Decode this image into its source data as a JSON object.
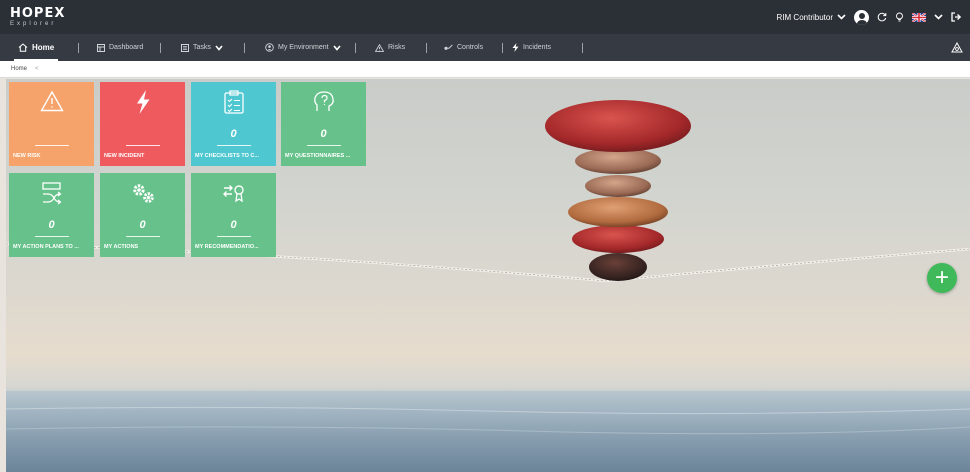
{
  "app": {
    "logo_main": "HOPEX",
    "logo_sub": "Explorer"
  },
  "header": {
    "user_role": "RIM Contributor"
  },
  "nav": {
    "home": "Home",
    "dashboard": "Dashboard",
    "tasks": "Tasks",
    "my_environment": "My Environment",
    "risks": "Risks",
    "controls": "Controls",
    "incidents": "Incidents"
  },
  "breadcrumb": {
    "current": "Home",
    "separator": "<"
  },
  "tiles": [
    {
      "label": "NEW RISK",
      "count": "",
      "color": "#f5a36a",
      "icon": "warning-icon"
    },
    {
      "label": "NEW INCIDENT",
      "count": "",
      "color": "#ef5a5f",
      "icon": "lightning-icon"
    },
    {
      "label": "MY CHECKLISTS TO C...",
      "count": "0",
      "color": "#4ec7d0",
      "icon": "checklist-icon"
    },
    {
      "label": "MY QUESTIONNAIRES ...",
      "count": "0",
      "color": "#66c28a",
      "icon": "questionnaire-icon"
    },
    {
      "label": "MY ACTION PLANS TO ...",
      "count": "0",
      "color": "#66c28a",
      "icon": "action-plan-icon"
    },
    {
      "label": "MY ACTIONS",
      "count": "0",
      "color": "#66c28a",
      "icon": "gears-icon"
    },
    {
      "label": "MY RECOMMENDATIO...",
      "count": "0",
      "color": "#66c28a",
      "icon": "recommendation-icon"
    }
  ],
  "fab": {
    "symbol": "+",
    "color": "#3fb95a"
  }
}
